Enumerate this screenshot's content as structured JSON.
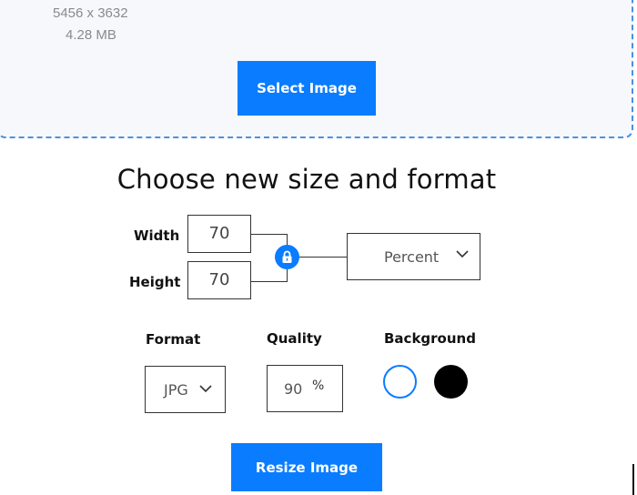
{
  "file": {
    "dimensions": "5456 x 3632",
    "size": "4.28 MB"
  },
  "upload": {
    "select_label": "Select Image"
  },
  "resize": {
    "title": "Choose new size and format",
    "width_label": "Width",
    "width_value": "70",
    "height_label": "Height",
    "height_value": "70",
    "unit_selected": "Percent",
    "format_label": "Format",
    "format_selected": "JPG",
    "quality_label": "Quality",
    "quality_value": "90",
    "quality_unit": "%",
    "background_label": "Background",
    "background_options": [
      "#ffffff",
      "#000000"
    ],
    "resize_label": "Resize Image"
  },
  "icons": {
    "lock": "lock-icon",
    "chevron": "chevron-down-icon"
  },
  "colors": {
    "accent": "#0a7cff",
    "panel_bg": "#f7f8fc",
    "dash_border": "#4a90e2"
  }
}
